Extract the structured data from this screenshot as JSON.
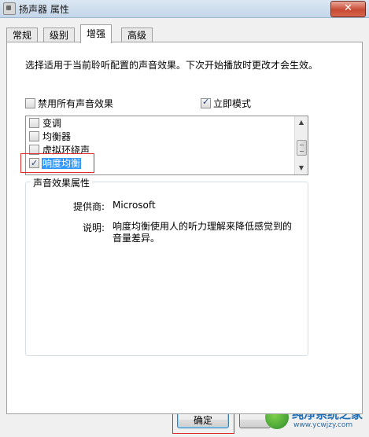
{
  "window": {
    "title": "扬声器 属性",
    "close_glyph": "✕"
  },
  "tabs": [
    {
      "label": "常规",
      "active": false
    },
    {
      "label": "级别",
      "active": false
    },
    {
      "label": "增强",
      "active": true
    },
    {
      "label": "高级",
      "active": false
    }
  ],
  "enhancements": {
    "description": "选择适用于当前聆听配置的声音效果。下次开始播放时更改才会生效。",
    "disable_all": {
      "label": "禁用所有声音效果",
      "checked": false
    },
    "immediate_mode": {
      "label": "立即模式",
      "checked": true
    },
    "effects": [
      {
        "label": "变调",
        "checked": false,
        "selected": false
      },
      {
        "label": "均衡器",
        "checked": false,
        "selected": false
      },
      {
        "label": "虚拟环绕声",
        "checked": false,
        "selected": false
      },
      {
        "label": "响度均衡",
        "checked": true,
        "selected": true
      }
    ]
  },
  "properties": {
    "title": "声音效果属性",
    "provider_label": "提供商:",
    "provider_value": "Microsoft",
    "description_label": "说明:",
    "description_value": "响度均衡使用人的听力理解来降低感觉到的音量差异。"
  },
  "buttons": {
    "ok": "确定"
  },
  "watermark": {
    "name": "纯净系统之家",
    "url": "www.ycwjzy.com"
  },
  "colors": {
    "selection": "#3399ff",
    "highlight_box": "#e02b2b"
  }
}
